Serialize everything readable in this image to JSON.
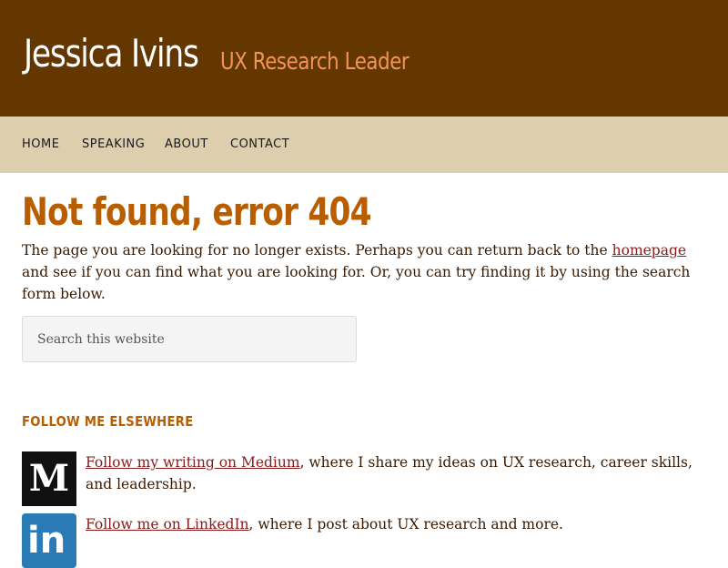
{
  "header": {
    "site_title": "Jessica Ivins",
    "site_description": "UX Research Leader"
  },
  "nav": {
    "items": [
      {
        "label": "HOME"
      },
      {
        "label": "SPEAKING"
      },
      {
        "label": "ABOUT"
      },
      {
        "label": "CONTACT"
      }
    ]
  },
  "main": {
    "title": "Not found, error 404",
    "text_before_link": "The page you are looking for no longer exists. Perhaps you can return back to the ",
    "homepage_link": "homepage",
    "text_after_link": " and see if you can find what you are looking for. Or, you can try finding it by using the search form below.",
    "search": {
      "placeholder": "Search this website",
      "value": ""
    }
  },
  "widget": {
    "title": "FOLLOW ME ELSEWHERE",
    "medium": {
      "icon": "medium-logo",
      "logo_letter": "M",
      "link_text": "Follow my writing on Medium",
      "rest_text": ", where I share my ideas on UX research, career skills, and leadership."
    },
    "linkedin": {
      "icon": "linkedin-logo",
      "logo_text": "in",
      "link_text": "Follow me on LinkedIn",
      "rest_text": ", where I post about UX research and more."
    }
  },
  "colors": {
    "header_bg": "#653700",
    "nav_bg": "#ddcfae",
    "accent": "#b85e00",
    "subtitle": "#f0955a",
    "link": "#8a1a1a"
  }
}
